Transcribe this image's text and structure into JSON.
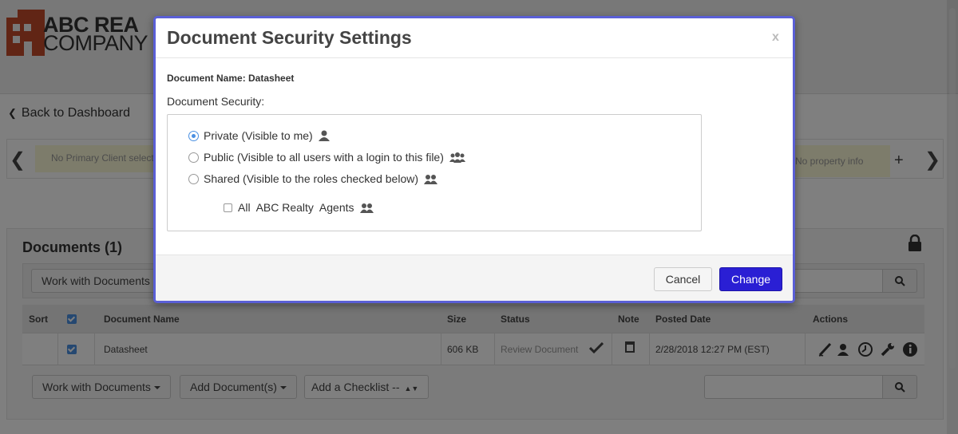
{
  "brand": {
    "logo_line1": "ABC REA",
    "logo_line2": "COMPANY"
  },
  "page": {
    "back_link": "Back to Dashboard",
    "client_info": "No Primary Client selected",
    "property_info": "No property info",
    "documents_title": "Documents (1)"
  },
  "toolbar": {
    "work_with_documents": "Work with Documents",
    "add_documents": "Add Document(s)",
    "add_checklist": "Add a Checklist --"
  },
  "table": {
    "headers": [
      "Sort",
      "Document Name",
      "Size",
      "Status",
      "Note",
      "Posted Date",
      "Actions"
    ],
    "rows": [
      {
        "name": "Datasheet",
        "size": "606 KB",
        "status": "Review Document",
        "posted": "2/28/2018 12:27 PM (EST)"
      }
    ]
  },
  "modal": {
    "title": "Document Security Settings",
    "close": "x",
    "document_name": "Document Name: Datasheet",
    "security_label": "Document Security:",
    "options": [
      {
        "label": "Private (Visible to me)",
        "selected": true
      },
      {
        "label": "Public (Visible to all users with a login to this file)",
        "selected": false
      },
      {
        "label": "Shared (Visible to the roles checked below)",
        "selected": false
      }
    ],
    "role_checkbox": "All  ABC Realty  Agents",
    "cancel": "Cancel",
    "change": "Change"
  },
  "colors": {
    "primary_button": "#2a1fd4",
    "radio_accent": "#4a90e2",
    "modal_border": "#5a5fd6"
  },
  "icons": {
    "single_user": "user-icon",
    "all_users": "users-group-icon",
    "shared_users": "users-pair-icon"
  }
}
